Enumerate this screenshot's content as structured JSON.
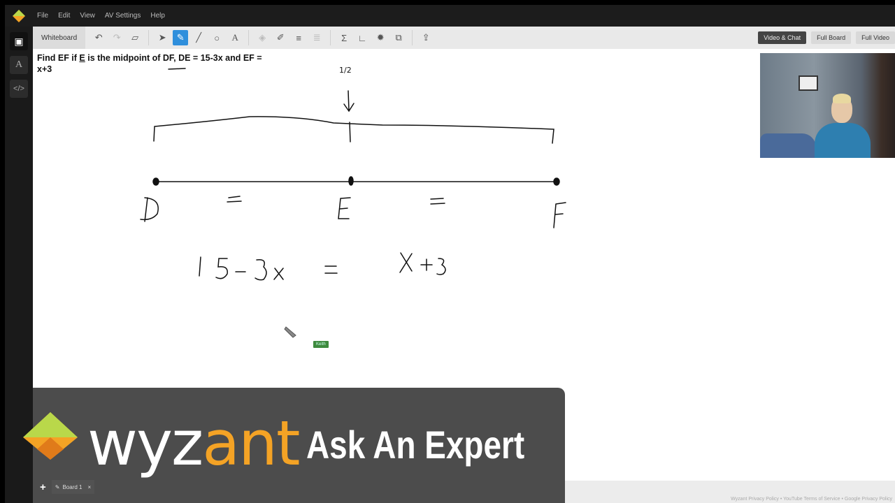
{
  "menu": [
    "File",
    "Edit",
    "View",
    "AV Settings",
    "Help"
  ],
  "toolbar": {
    "tab": "Whiteboard",
    "view_buttons": [
      "Video & Chat",
      "Full Board",
      "Full Video"
    ],
    "active_tool": "pen"
  },
  "problem": {
    "text_before": "Find EF if ",
    "underlined": "E",
    "text_after": " is the midpoint of DF, DE = 15-3x and EF = x+3"
  },
  "handwriting": {
    "half": "1/2",
    "points": [
      "D",
      "E",
      "F"
    ],
    "equation_left": "15-3x",
    "equals": "=",
    "equation_right": "x+3"
  },
  "cursor_user": "Keith",
  "boards": {
    "tab": "Board 1",
    "add": "+",
    "close": "×"
  },
  "overlay": {
    "brand_wy": "wyz",
    "brand_ant": "ant",
    "tagline": "Ask An Expert"
  },
  "footer": "Wyzant Privacy Policy • YouTube Terms of Service • Google Privacy Policy",
  "colors": {
    "accent": "#2f8fdc",
    "brand_orange": "#f4a325",
    "cursor_tag": "#3e8a3e"
  }
}
